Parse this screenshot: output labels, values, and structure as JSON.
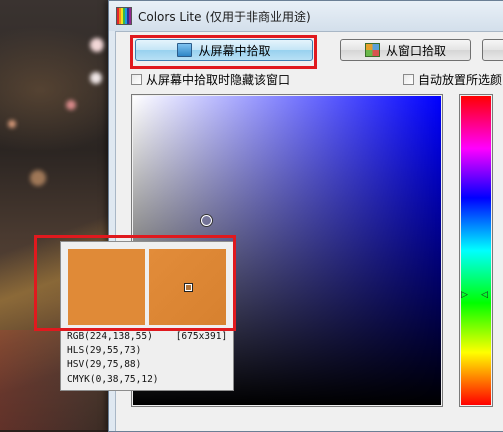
{
  "window": {
    "title": "Colors Lite (仅用于非商业用途)"
  },
  "toolbar": {
    "pick_screen_label": "从屏幕中拾取",
    "pick_window_label": "从窗口拾取"
  },
  "options": {
    "hide_window_label": "从屏幕中拾取时隐藏该窗口",
    "auto_place_label": "自动放置所选颜"
  },
  "magnifier": {
    "rgb": "RGB(224,138,55)",
    "coords": "[675x391]",
    "hls": "HLS(29,55,73)",
    "hsv": "HSV(29,75,88)",
    "cmyk": "CMYK(0,38,75,12)"
  },
  "hue_marker": {
    "left": "▷",
    "right": "◁"
  },
  "colors": {
    "picked": "#e08a37",
    "highlight": "#e0191e",
    "hue_selected": "#0000ff"
  },
  "icons": [
    "app-rainbow-icon",
    "screen-icon",
    "window-grid-icon"
  ]
}
